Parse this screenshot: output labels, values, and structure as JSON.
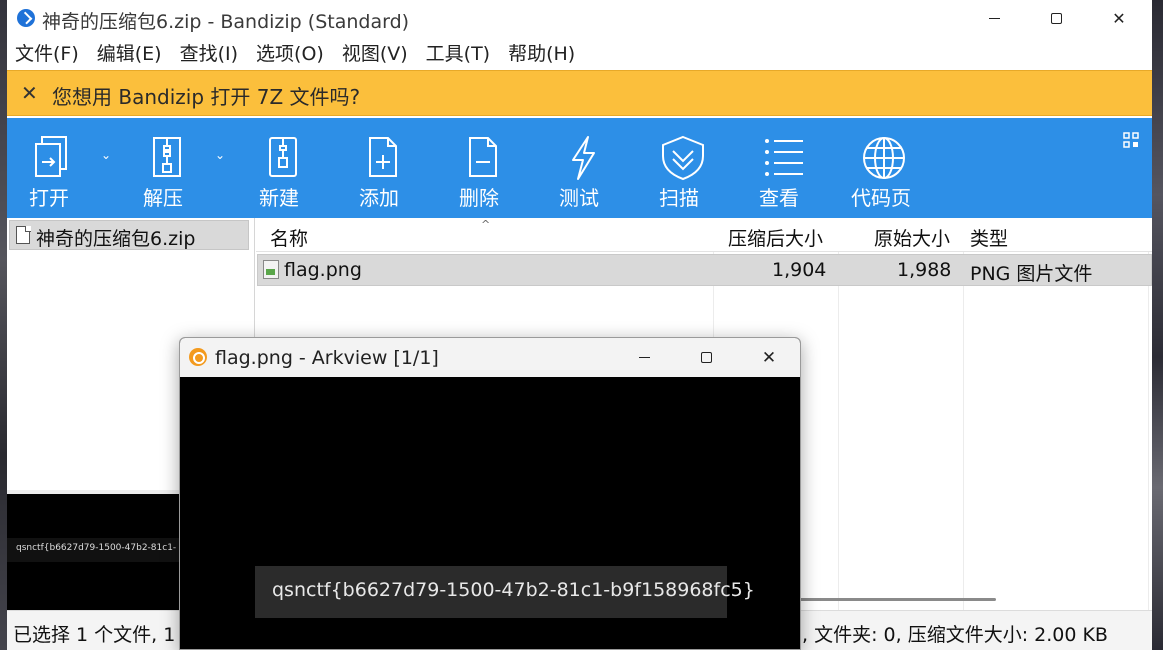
{
  "main_window": {
    "title": "神奇的压缩包6.zip - Bandizip (Standard)",
    "controls": {
      "minimize": "minimize-icon",
      "maximize": "maximize-icon",
      "close": "✕"
    }
  },
  "menu": [
    {
      "label": "文件(F)"
    },
    {
      "label": "编辑(E)"
    },
    {
      "label": "查找(I)"
    },
    {
      "label": "选项(O)"
    },
    {
      "label": "视图(V)"
    },
    {
      "label": "工具(T)"
    },
    {
      "label": "帮助(H)"
    }
  ],
  "notification": {
    "close": "✕",
    "text": "您想用 Bandizip 打开 7Z 文件吗?",
    "color": "#fbbf3c"
  },
  "toolbar": {
    "color": "#2d8fe7",
    "items": [
      {
        "label": "打开",
        "icon": "open-icon"
      },
      {
        "label": "解压",
        "icon": "extract-icon"
      },
      {
        "label": "新建",
        "icon": "new-archive-icon"
      },
      {
        "label": "添加",
        "icon": "add-file-icon"
      },
      {
        "label": "删除",
        "icon": "delete-file-icon"
      },
      {
        "label": "测试",
        "icon": "test-lightning-icon"
      },
      {
        "label": "扫描",
        "icon": "scan-shield-icon"
      },
      {
        "label": "查看",
        "icon": "view-list-icon"
      },
      {
        "label": "代码页",
        "icon": "codepage-globe-icon"
      }
    ],
    "dropdown_glyph": "⌄"
  },
  "tree": {
    "items": [
      {
        "label": "神奇的压缩包6.zip"
      }
    ]
  },
  "preview_thumbnail": {
    "text": "qsnctf{b6627d79-1500-47b2-81c1-"
  },
  "file_list": {
    "sort_glyph": "^",
    "columns": {
      "name": "名称",
      "compressed": "压缩后大小",
      "original": "原始大小",
      "type": "类型"
    },
    "rows": [
      {
        "name": "flag.png",
        "compressed": "1,904",
        "original": "1,988",
        "type": "PNG 图片文件"
      }
    ]
  },
  "status": {
    "left": "已选择 1 个文件, 1",
    "right": ", 文件夹: 0, 压缩文件大小: 2.00 KB"
  },
  "arkview": {
    "title": "flag.png - Arkview [1/1]",
    "controls": {
      "close": "✕"
    },
    "image_text": "qsnctf{b6627d79-1500-47b2-81c1-b9f158968fc5}"
  }
}
